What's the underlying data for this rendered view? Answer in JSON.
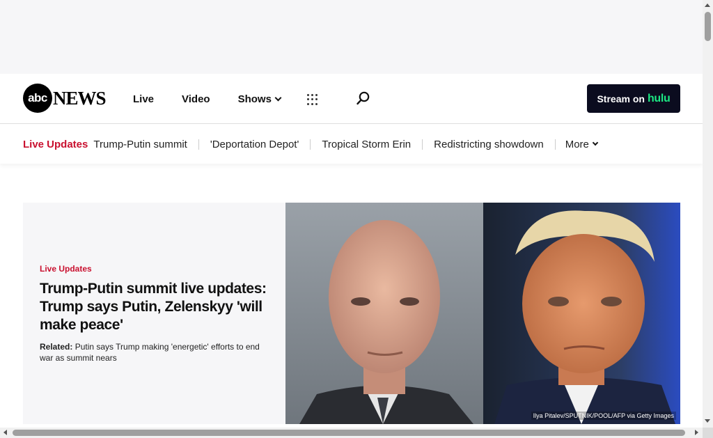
{
  "header": {
    "logo_mark": "abc",
    "logo_word": "NEWS",
    "nav": [
      {
        "label": "Live"
      },
      {
        "label": "Video"
      },
      {
        "label": "Shows"
      }
    ],
    "stream_label": "Stream on",
    "stream_brand": "hulu"
  },
  "trending": {
    "live_label": "Live Updates",
    "items": [
      {
        "label": "Trump-Putin summit"
      },
      {
        "label": "'Deportation Depot'"
      },
      {
        "label": "Tropical Storm Erin"
      },
      {
        "label": "Redistricting showdown"
      }
    ],
    "more_label": "More"
  },
  "hero": {
    "kicker": "Live Updates",
    "headline": "Trump-Putin summit live updates: Trump says Putin, Zelenskyy 'will make peace'",
    "related_prefix": "Related:",
    "related_text": "Putin says Trump making 'energetic' efforts to end war as summit nears",
    "image_credit": "Ilya Pitalev/SPUTNIK/POOL/AFP via Getty Images"
  },
  "colors": {
    "accent_red": "#c9102f",
    "hulu_green": "#1ce783",
    "stream_bg": "#0b0c1f"
  },
  "icons": [
    "grid-menu-icon",
    "search-icon",
    "chevron-down-icon"
  ]
}
